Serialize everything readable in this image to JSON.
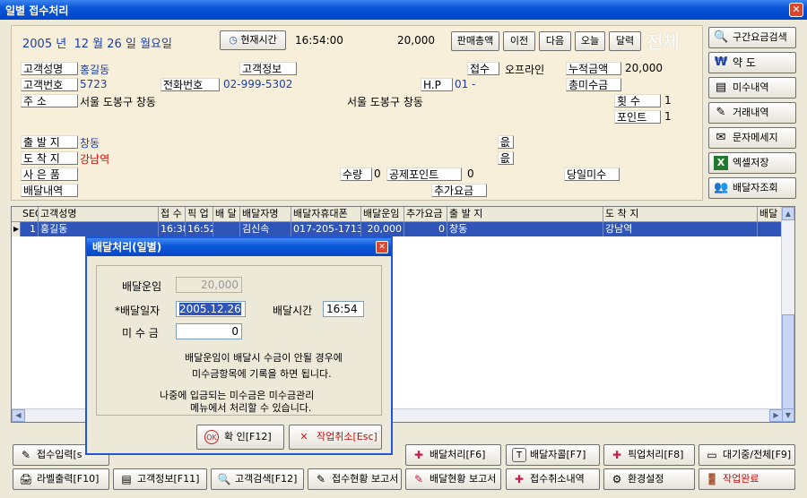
{
  "window": {
    "title": "일별 접수처리",
    "close_glyph": "✕"
  },
  "date": {
    "year": "2005",
    "year_label": "년",
    "month": "12",
    "month_label": "월",
    "day": "26",
    "day_label": "일",
    "weekday": "월요일"
  },
  "now_button": "현재시간",
  "time": "16:54:00",
  "amount": "20,000",
  "nav_buttons": {
    "sales_total": "판매총액",
    "prev": "이전",
    "next": "다음",
    "today": "오늘",
    "calendar": "달력"
  },
  "all_label": "전체",
  "fields": {
    "customer_name_label": "고객성명",
    "customer_name": "홍길동",
    "customer_info_label": "고객정보",
    "receipt_label": "접수",
    "receipt_value": "오프라인",
    "cumulative_label": "누적금액",
    "cumulative_value": "20,000",
    "customer_no_label": "고객번호",
    "customer_no": "5723",
    "phone_label": "전화번호",
    "phone": "02-999-5302",
    "hp_label": "H.P",
    "hp": "01 -",
    "total_unpaid_label": "총미수금",
    "address_label": "주    소",
    "address": "서울 도봉구 창동",
    "address2": "서울 도봉구 창동",
    "count_label": "횟   수",
    "count": "1",
    "points_label": "포인트",
    "points": "1",
    "origin_label": "출 발 지",
    "origin": "창동",
    "origin_mark": "읎",
    "dest_label": "도 착 지",
    "dest": "강남역",
    "dest_mark": "읎",
    "gift_label": "사 은 품",
    "qty_label": "수량",
    "qty": "0",
    "deduct_label": "공제포인트",
    "deduct": "0",
    "same_day_unpaid_label": "당일미수",
    "delivery_detail_label": "배달내역",
    "extra_fee_label": "추가요금"
  },
  "right_buttons": [
    {
      "icon": "🔍",
      "label": "구간요금검색"
    },
    {
      "icon": "₩",
      "label": "약 도"
    },
    {
      "icon": "▤",
      "label": "미수내역"
    },
    {
      "icon": "✎",
      "label": "거래내역"
    },
    {
      "icon": "✉",
      "label": "문자메세지"
    },
    {
      "icon": "X",
      "label": "엑셀저장"
    },
    {
      "icon": "👥",
      "label": "배달자조회"
    }
  ],
  "grid": {
    "headers": [
      "SEQ",
      "고객성명",
      "접 수",
      "픽 업",
      "배 달",
      "배달자명",
      "배달자휴대폰",
      "배달운임",
      "추가요금",
      "출 발 지",
      "도 착 지",
      "배달"
    ],
    "row": {
      "pointer": "▶",
      "seq": "1",
      "name": "홍길동",
      "receipt": "16:38",
      "pickup": "16:52",
      "deliver": "",
      "courier": "김신속",
      "courier_phone": "017-205-1713",
      "fare": "20,000",
      "extra": "0",
      "origin": "창동",
      "dest": "강남역",
      "delivery": ""
    },
    "scroll": {
      "up": "▲",
      "down": "▼",
      "left": "◀",
      "right": "▶"
    }
  },
  "dialog": {
    "title": "배달처리(일별)",
    "close_glyph": "✕",
    "fare_label": "배달운임",
    "fare": "20,000",
    "date_label": "*배달일자",
    "date": "2005.12.26",
    "time_label": "배달시간",
    "time": "16:54",
    "unpaid_label": "미 수 금",
    "unpaid": "0",
    "note1": "배달운임이 배달시 수금이 안될 경우에",
    "note2": "미수금항목에 기록을 하면 됩니다.",
    "note3": "나중에 입금되는 미수금은 미수금관리",
    "note4": "메뉴에서 처리할 수 있습니다.",
    "ok_icon": "OK",
    "ok": "확 인[F12]",
    "cancel_icon": "✕",
    "cancel": "작업취소[Esc]"
  },
  "bottom_row1": [
    {
      "icon": "✎",
      "label": "접수입력[s"
    },
    {
      "icon": "",
      "label": ""
    },
    {
      "icon": "",
      "label": ""
    },
    {
      "icon": "",
      "label": ""
    },
    {
      "icon": "✚",
      "label": "배달처리[F6]"
    },
    {
      "icon": "T",
      "label": "배달자콜[F7]"
    },
    {
      "icon": "✚",
      "label": "픽업처리[F8]"
    },
    {
      "icon": "▭",
      "label": "대기중/전체[F9]"
    }
  ],
  "bottom_row2": [
    {
      "icon": "🖨",
      "label": "라벨출력[F10]"
    },
    {
      "icon": "▤",
      "label": "고객정보[F11]"
    },
    {
      "icon": "🔍",
      "label": "고객검색[F12]"
    },
    {
      "icon": "✎",
      "label": "접수현황 보고서"
    },
    {
      "icon": "✎",
      "label": "배달현황 보고서"
    },
    {
      "icon": "✚",
      "label": "접수취소내역"
    },
    {
      "icon": "⚙",
      "label": "환경설정"
    },
    {
      "icon": "🚪",
      "label": "작업완료"
    }
  ]
}
